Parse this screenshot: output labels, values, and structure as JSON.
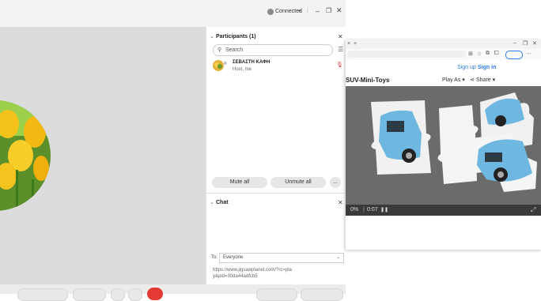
{
  "meeting": {
    "status": "Connected",
    "participants": {
      "header": "Participants (1)",
      "search_placeholder": "Search",
      "list": [
        {
          "name": "ΣΕΒΑΣΤΗ ΚΑΦΗ",
          "role": "Host, me"
        }
      ],
      "mute_all": "Mute all",
      "unmute_all": "Unmute all",
      "more": "..."
    },
    "chat": {
      "header": "Chat",
      "to_label": "To:",
      "to_value": "Everyone",
      "message": "https://www.jigsawplanet.com/?rc=play&pid=30da44adfcb5"
    }
  },
  "browser": {
    "sign_up": "Sign up",
    "sign_in": "Sign in",
    "puzzle_title": "SUV-Mini-Toys",
    "play_as": "Play As ▾",
    "share": "Share ▾",
    "progress": "0%",
    "timer": "0:07",
    "accent": "#2b7de9"
  },
  "colors": {
    "accent": "#2b7de9",
    "connected": "#7a7a7a",
    "end_call": "#e53935"
  }
}
